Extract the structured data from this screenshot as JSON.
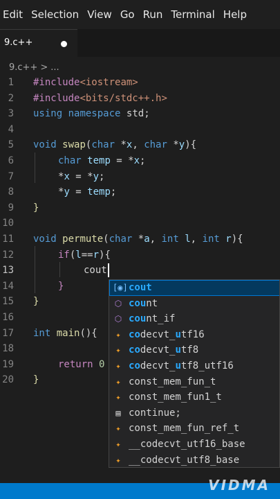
{
  "menu": [
    "Edit",
    "Selection",
    "View",
    "Go",
    "Run",
    "Terminal",
    "Help"
  ],
  "tab": {
    "label": "9.c++"
  },
  "breadcrumb": {
    "file": "9.c++",
    "separator": ">",
    "rest": "..."
  },
  "lines": [
    {
      "n": "1"
    },
    {
      "n": "2"
    },
    {
      "n": "3"
    },
    {
      "n": "4"
    },
    {
      "n": "5"
    },
    {
      "n": "6"
    },
    {
      "n": "7"
    },
    {
      "n": "8"
    },
    {
      "n": "9"
    },
    {
      "n": "10"
    },
    {
      "n": "11"
    },
    {
      "n": "12"
    },
    {
      "n": "13"
    },
    {
      "n": "14"
    },
    {
      "n": "15"
    },
    {
      "n": "16"
    },
    {
      "n": "17"
    },
    {
      "n": "18"
    },
    {
      "n": "19"
    },
    {
      "n": "20"
    }
  ],
  "code": {
    "l1a": "#include",
    "l1b": "<iostream>",
    "l2a": "#include",
    "l2b": "<bits/stdc++.h>",
    "l3a": "using",
    "l3b": "namespace",
    "l3c": "std",
    "l5a": "void",
    "l5b": "swap",
    "l5c": "char",
    "l5d": "x",
    "l5e": "char",
    "l5f": "y",
    "l6a": "char",
    "l6b": "temp",
    "l6c": "x",
    "l7a": "x",
    "l7b": "y",
    "l8a": "y",
    "l8b": "temp",
    "l11a": "void",
    "l11b": "permute",
    "l11c": "char",
    "l11d": "a",
    "l11e": "int",
    "l11f": "l",
    "l11g": "int",
    "l11h": "r",
    "l12a": "if",
    "l12b": "l",
    "l12c": "r",
    "l13a": "cout",
    "l17a": "int",
    "l17b": "main",
    "l19a": "return",
    "l19b": "0"
  },
  "suggestions": [
    {
      "icon": "variable-icon",
      "match": "cout",
      "rest": ""
    },
    {
      "icon": "cube-icon",
      "match": "cou",
      "rest": "nt"
    },
    {
      "icon": "cube-icon",
      "match": "cou",
      "rest": "nt_if"
    },
    {
      "icon": "class-icon",
      "pre": "c",
      "match2": "o",
      "mid": "de",
      "match3": "c",
      "rest": "vt_",
      "match4": "u",
      "tail": "tf16"
    },
    {
      "icon": "class-icon",
      "pre": "c",
      "match2": "o",
      "mid": "de",
      "match3": "c",
      "rest": "vt_",
      "match4": "u",
      "tail": "tf8"
    },
    {
      "icon": "class-icon",
      "pre": "c",
      "match2": "o",
      "mid": "de",
      "match3": "c",
      "rest": "vt_",
      "match4": "u",
      "tail": "tf8_utf16"
    },
    {
      "icon": "class-icon",
      "text": "const_mem_fun_t"
    },
    {
      "icon": "class-icon",
      "text": "const_mem_fun1_t"
    },
    {
      "icon": "keyword-icon",
      "text": "continue;"
    },
    {
      "icon": "class-icon",
      "text": "const_mem_fun_ref_t"
    },
    {
      "icon": "class-icon",
      "text": "__codecvt_utf16_base"
    },
    {
      "icon": "class-icon",
      "text": "__codecvt_utf8_base"
    }
  ],
  "watermark": "VIDMA",
  "colors": {
    "statusbar": "#007acc",
    "selection": "#04395e",
    "match": "#2aaaff"
  }
}
